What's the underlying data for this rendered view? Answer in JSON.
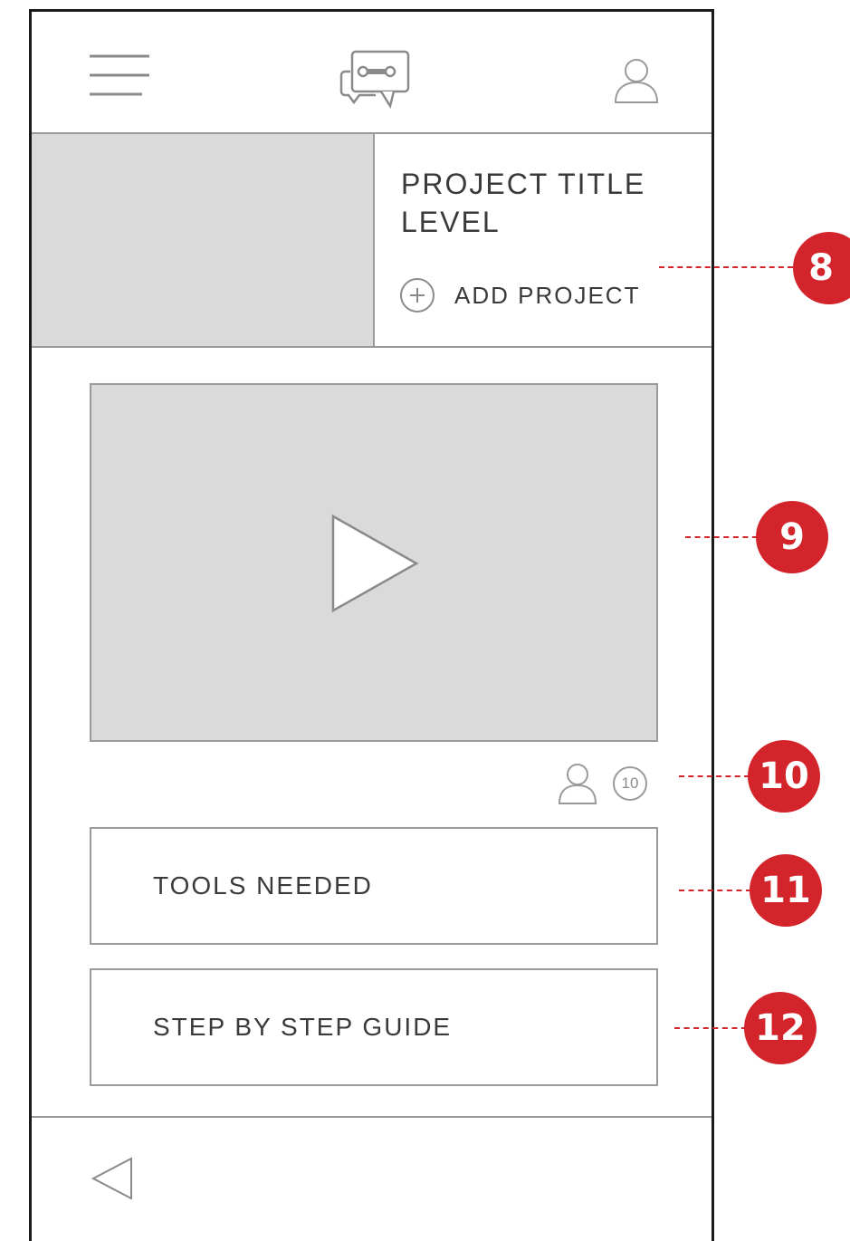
{
  "colors": {
    "callout": "#d3232b",
    "placeholder": "#dadada",
    "line": "#9a9a9a",
    "frame": "#1a1a1a"
  },
  "header": {
    "menu_icon": "hamburger-icon",
    "logo_icon": "chat-wrench-icon",
    "profile_icon": "user-icon"
  },
  "project": {
    "title": "PROJECT TITLE",
    "level": "LEVEL",
    "add_label": "ADD PROJECT",
    "add_icon": "plus-circle-icon"
  },
  "video": {
    "play_icon": "play-icon"
  },
  "participants": {
    "icon": "user-icon",
    "count": "10"
  },
  "sections": {
    "tools": "TOOLS NEEDED",
    "guide": "STEP BY STEP GUIDE"
  },
  "footer": {
    "back_icon": "back-triangle-icon"
  },
  "callouts": [
    "8",
    "9",
    "10",
    "11",
    "12"
  ]
}
